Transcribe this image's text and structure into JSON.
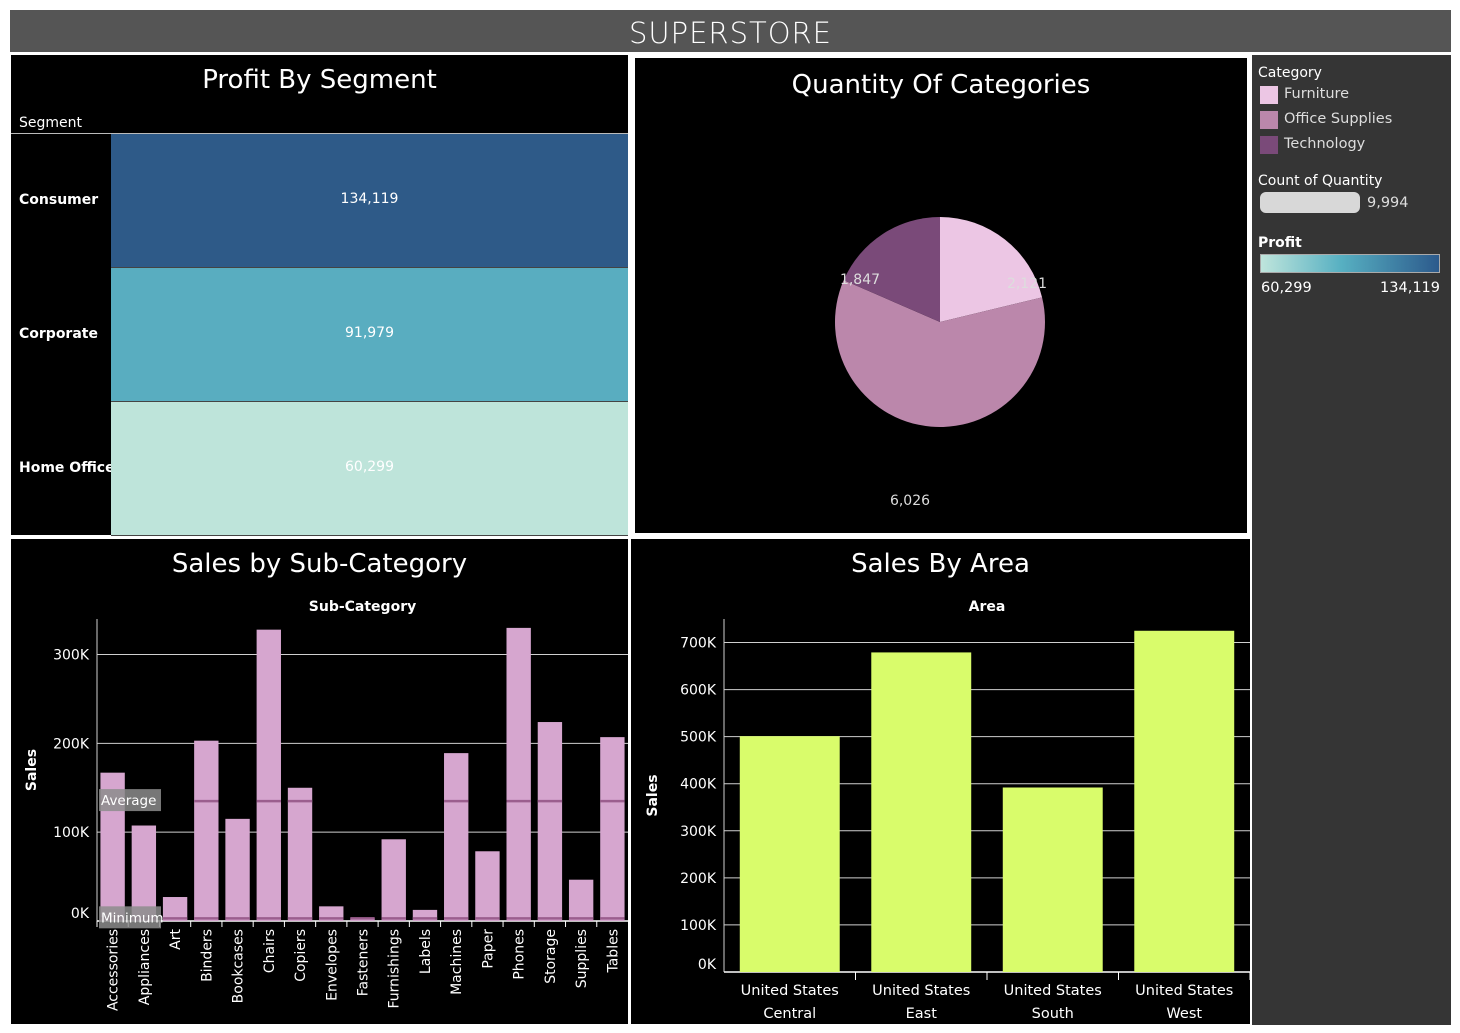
{
  "header": {
    "title": "SUPERSTORE"
  },
  "profit_by_segment": {
    "title": "Profit By Segment",
    "column_header": "Segment",
    "rows": [
      {
        "segment": "Consumer",
        "profit": "134,119",
        "color": "#2e5a88"
      },
      {
        "segment": "Corporate",
        "profit": "91,979",
        "color": "#59adc0"
      },
      {
        "segment": "Home Office",
        "profit": "60,299",
        "color": "#bee4da"
      }
    ]
  },
  "quantity_of_categories": {
    "title": "Quantity Of Categories"
  },
  "sales_by_subcategory": {
    "title": "Sales by Sub-Category"
  },
  "sales_by_area": {
    "title": "Sales By Area"
  },
  "legend": {
    "category_title": "Category",
    "categories": [
      {
        "label": "Furniture",
        "color": "#ecc6e4"
      },
      {
        "label": "Office Supplies",
        "color": "#bb87ab"
      },
      {
        "label": "Technology",
        "color": "#7a4a79"
      }
    ],
    "count_title": "Count of Quantity",
    "count_value": "9,994",
    "profit_title": "Profit",
    "profit_min": "60,299",
    "profit_max": "134,119"
  },
  "chart_data": [
    {
      "type": "pie",
      "title": "Quantity Of Categories",
      "categories": [
        "Furniture",
        "Office Supplies",
        "Technology"
      ],
      "values": [
        2121,
        6026,
        1847
      ],
      "value_labels": [
        "2,121",
        "6,026",
        "1,847"
      ],
      "colors": [
        "#ecc6e4",
        "#bb87ab",
        "#7a4a79"
      ]
    },
    {
      "type": "bar",
      "title": "Sales by Sub-Category",
      "xlabel": "Sub-Category",
      "ylabel": "Sales",
      "ylim": [
        0,
        340000
      ],
      "yticks": [
        0,
        100000,
        200000,
        300000
      ],
      "ytick_labels": [
        "0K",
        "100K",
        "200K",
        "300K"
      ],
      "categories": [
        "Accessories",
        "Appliances",
        "Art",
        "Binders",
        "Bookcases",
        "Chairs",
        "Copiers",
        "Envelopes",
        "Fasteners",
        "Furnishings",
        "Labels",
        "Machines",
        "Paper",
        "Phones",
        "Storage",
        "Supplies",
        "Tables"
      ],
      "values": [
        167000,
        107500,
        27000,
        203000,
        115000,
        328000,
        150000,
        16500,
        3000,
        92000,
        12500,
        189000,
        78500,
        330000,
        224000,
        46500,
        207000
      ],
      "reference_lines": [
        {
          "label": "Average",
          "value": 135000
        },
        {
          "label": "Minimum",
          "value": 3000
        }
      ],
      "color": "#d6a6cf"
    },
    {
      "type": "bar",
      "title": "Sales By Area",
      "xlabel": "Area",
      "ylabel": "Sales",
      "ylim": [
        0,
        750000
      ],
      "yticks": [
        0,
        100000,
        200000,
        300000,
        400000,
        500000,
        600000,
        700000
      ],
      "ytick_labels": [
        "0K",
        "100K",
        "200K",
        "300K",
        "400K",
        "500K",
        "600K",
        "700K"
      ],
      "categories": [
        [
          "United States",
          "Central"
        ],
        [
          "United States",
          "East"
        ],
        [
          "United States",
          "South"
        ],
        [
          "United States",
          "West"
        ]
      ],
      "values": [
        501000,
        679000,
        392000,
        725000
      ],
      "color": "#d9fc6b"
    }
  ]
}
